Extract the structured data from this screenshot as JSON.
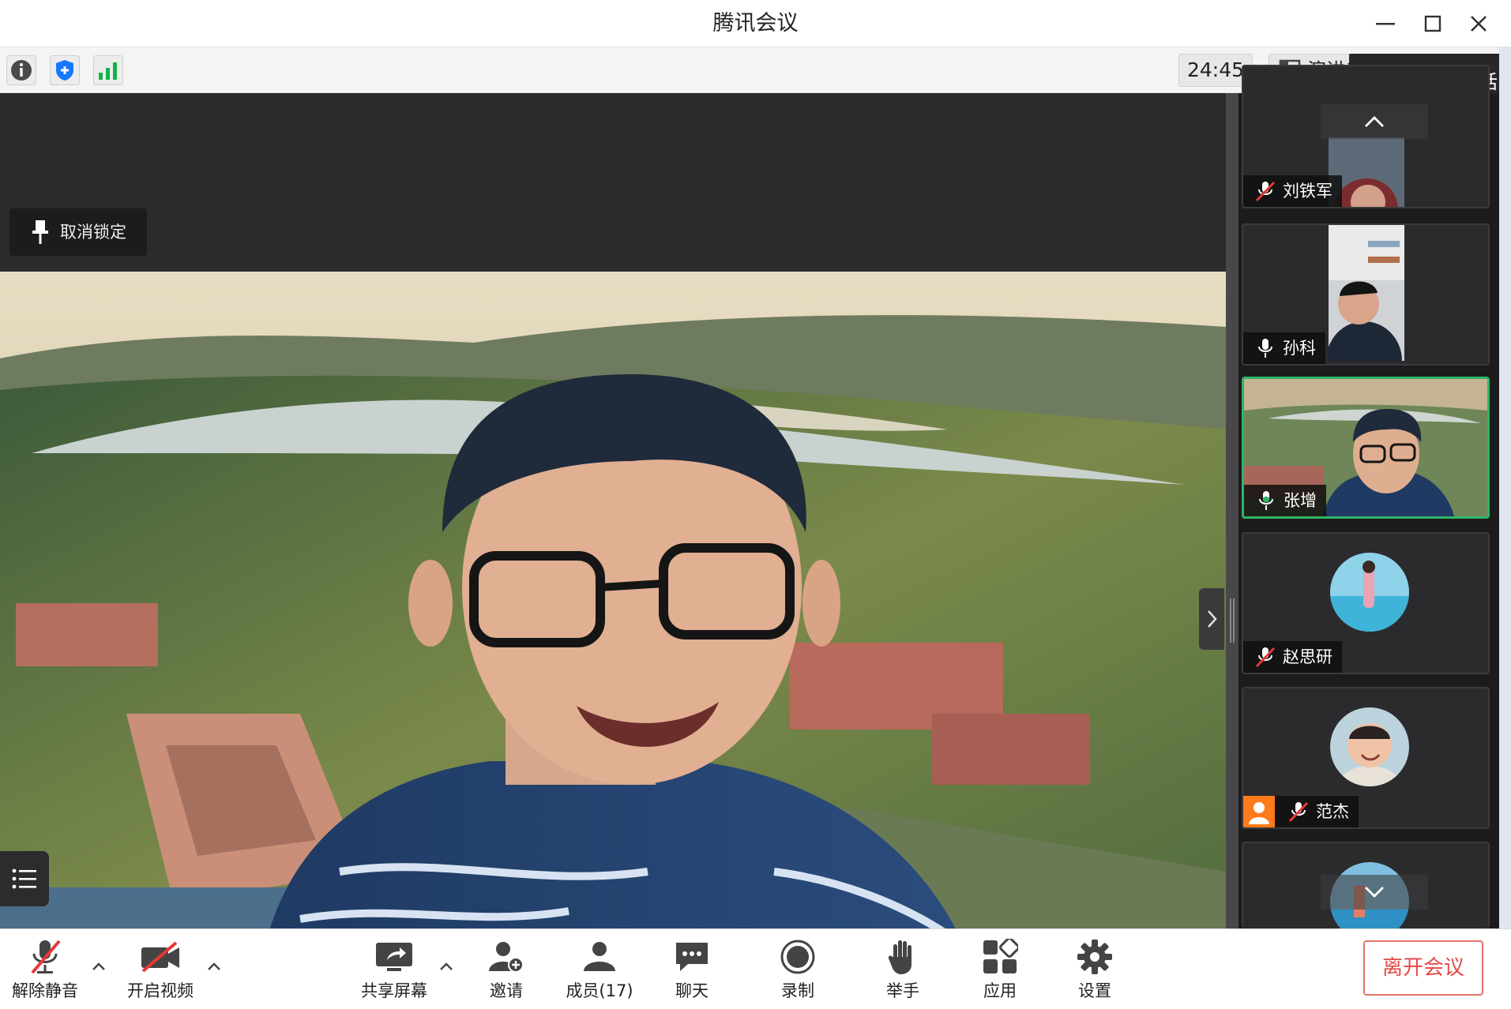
{
  "window": {
    "title": "腾讯会议"
  },
  "toolbar": {
    "timer": "24:45",
    "presenter_label": "演讲者"
  },
  "speaking": {
    "label": "正在讲话: 张增"
  },
  "main": {
    "unlock_label": "取消锁定"
  },
  "participants": [
    {
      "name": "刘铁军",
      "mic": "muted",
      "active": false
    },
    {
      "name": "孙科",
      "mic": "on",
      "active": false
    },
    {
      "name": "张增",
      "mic": "speaking",
      "active": true
    },
    {
      "name": "赵思研",
      "mic": "muted",
      "active": false
    },
    {
      "name": "范杰",
      "mic": "muted",
      "active": false
    }
  ],
  "controls": {
    "unmute": "解除静音",
    "start_video": "开启视频",
    "share_screen": "共享屏幕",
    "invite": "邀请",
    "members": "成员(17)",
    "chat": "聊天",
    "record": "录制",
    "raise_hand": "举手",
    "apps": "应用",
    "settings": "设置",
    "leave": "离开会议"
  },
  "colors": {
    "active_border": "#2fb565",
    "leave_text": "#e24a45",
    "mute_red": "#e53935",
    "shield_blue": "#1677ff",
    "signal_green": "#12b34a"
  }
}
